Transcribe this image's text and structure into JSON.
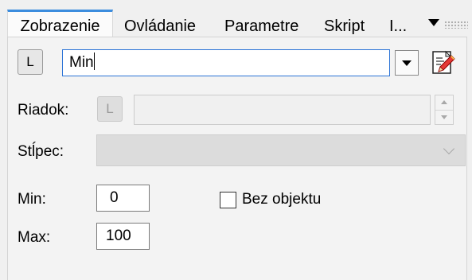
{
  "tabs": {
    "items": [
      "Zobrazenie",
      "Ovládanie",
      "Parametre",
      "Skript",
      "I..."
    ],
    "active": "Zobrazenie"
  },
  "caption": {
    "l_button": "L",
    "value": "Min"
  },
  "row": {
    "label": "Riadok:",
    "l_button": "L",
    "value": ""
  },
  "column": {
    "label": "Stĺpec:",
    "value": ""
  },
  "min": {
    "label": "Min:",
    "value": "0"
  },
  "max": {
    "label": "Max:",
    "value": "100"
  },
  "no_object": {
    "label": "Bez objektu",
    "checked": false
  },
  "colors": {
    "active_tab_accent": "#3c8dde",
    "focus_border": "#2b73d6"
  },
  "icons": [
    "dropdown-arrow-icon",
    "edit-script-icon",
    "spinner-up-icon",
    "spinner-down-icon",
    "chevron-down-icon",
    "tab-overflow-icon",
    "drag-grip-icon"
  ]
}
